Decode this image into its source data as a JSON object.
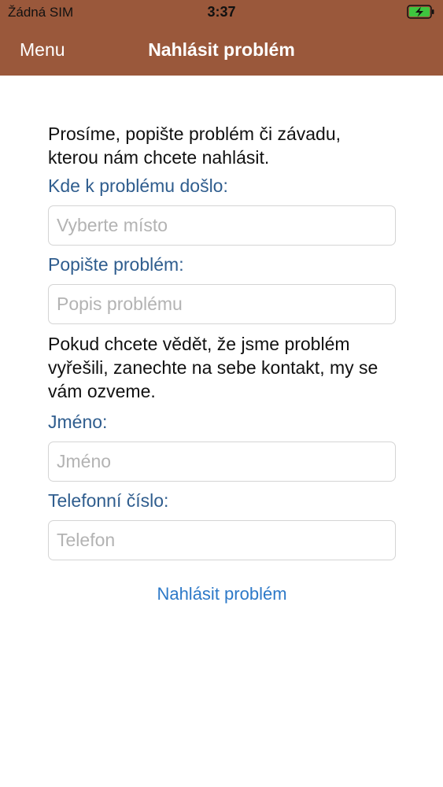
{
  "status_bar": {
    "carrier": "Žádná SIM",
    "time": "3:37",
    "battery_icon": "battery-charging-icon",
    "battery_color": "#3ec53e"
  },
  "nav": {
    "menu_label": "Menu",
    "title": "Nahlásit problém"
  },
  "form": {
    "intro": "Prosíme, popište problém či závadu, kterou nám chcete nahlásit.",
    "location_label": "Kde k problému došlo:",
    "location_placeholder": "Vyberte místo",
    "description_label": "Popište problém:",
    "description_placeholder": "Popis problému",
    "contact_info": "Pokud chcete vědět, že jsme problém vyřešili, zanechte na sebe kontakt, my se vám ozveme.",
    "name_label": "Jméno:",
    "name_placeholder": "Jméno",
    "phone_label": "Telefonní číslo:",
    "phone_placeholder": "Telefon",
    "submit_label": "Nahlásit problém"
  },
  "colors": {
    "header_background": "#9a583b",
    "label_color": "#2f5d8e",
    "link_color": "#2d79c8"
  }
}
